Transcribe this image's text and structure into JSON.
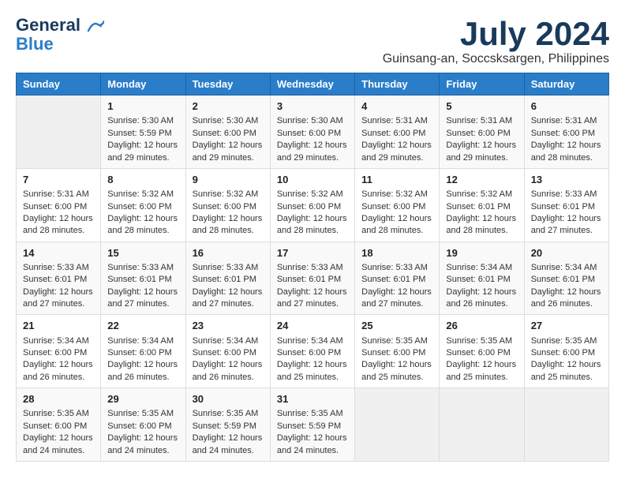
{
  "header": {
    "logo_line1": "General",
    "logo_line2": "Blue",
    "month_year": "July 2024",
    "location": "Guinsang-an, Soccsksargen, Philippines"
  },
  "weekdays": [
    "Sunday",
    "Monday",
    "Tuesday",
    "Wednesday",
    "Thursday",
    "Friday",
    "Saturday"
  ],
  "weeks": [
    [
      {
        "day": "",
        "info": ""
      },
      {
        "day": "1",
        "info": "Sunrise: 5:30 AM\nSunset: 5:59 PM\nDaylight: 12 hours\nand 29 minutes."
      },
      {
        "day": "2",
        "info": "Sunrise: 5:30 AM\nSunset: 6:00 PM\nDaylight: 12 hours\nand 29 minutes."
      },
      {
        "day": "3",
        "info": "Sunrise: 5:30 AM\nSunset: 6:00 PM\nDaylight: 12 hours\nand 29 minutes."
      },
      {
        "day": "4",
        "info": "Sunrise: 5:31 AM\nSunset: 6:00 PM\nDaylight: 12 hours\nand 29 minutes."
      },
      {
        "day": "5",
        "info": "Sunrise: 5:31 AM\nSunset: 6:00 PM\nDaylight: 12 hours\nand 29 minutes."
      },
      {
        "day": "6",
        "info": "Sunrise: 5:31 AM\nSunset: 6:00 PM\nDaylight: 12 hours\nand 28 minutes."
      }
    ],
    [
      {
        "day": "7",
        "info": "Sunrise: 5:31 AM\nSunset: 6:00 PM\nDaylight: 12 hours\nand 28 minutes."
      },
      {
        "day": "8",
        "info": "Sunrise: 5:32 AM\nSunset: 6:00 PM\nDaylight: 12 hours\nand 28 minutes."
      },
      {
        "day": "9",
        "info": "Sunrise: 5:32 AM\nSunset: 6:00 PM\nDaylight: 12 hours\nand 28 minutes."
      },
      {
        "day": "10",
        "info": "Sunrise: 5:32 AM\nSunset: 6:00 PM\nDaylight: 12 hours\nand 28 minutes."
      },
      {
        "day": "11",
        "info": "Sunrise: 5:32 AM\nSunset: 6:00 PM\nDaylight: 12 hours\nand 28 minutes."
      },
      {
        "day": "12",
        "info": "Sunrise: 5:32 AM\nSunset: 6:01 PM\nDaylight: 12 hours\nand 28 minutes."
      },
      {
        "day": "13",
        "info": "Sunrise: 5:33 AM\nSunset: 6:01 PM\nDaylight: 12 hours\nand 27 minutes."
      }
    ],
    [
      {
        "day": "14",
        "info": "Sunrise: 5:33 AM\nSunset: 6:01 PM\nDaylight: 12 hours\nand 27 minutes."
      },
      {
        "day": "15",
        "info": "Sunrise: 5:33 AM\nSunset: 6:01 PM\nDaylight: 12 hours\nand 27 minutes."
      },
      {
        "day": "16",
        "info": "Sunrise: 5:33 AM\nSunset: 6:01 PM\nDaylight: 12 hours\nand 27 minutes."
      },
      {
        "day": "17",
        "info": "Sunrise: 5:33 AM\nSunset: 6:01 PM\nDaylight: 12 hours\nand 27 minutes."
      },
      {
        "day": "18",
        "info": "Sunrise: 5:33 AM\nSunset: 6:01 PM\nDaylight: 12 hours\nand 27 minutes."
      },
      {
        "day": "19",
        "info": "Sunrise: 5:34 AM\nSunset: 6:01 PM\nDaylight: 12 hours\nand 26 minutes."
      },
      {
        "day": "20",
        "info": "Sunrise: 5:34 AM\nSunset: 6:01 PM\nDaylight: 12 hours\nand 26 minutes."
      }
    ],
    [
      {
        "day": "21",
        "info": "Sunrise: 5:34 AM\nSunset: 6:00 PM\nDaylight: 12 hours\nand 26 minutes."
      },
      {
        "day": "22",
        "info": "Sunrise: 5:34 AM\nSunset: 6:00 PM\nDaylight: 12 hours\nand 26 minutes."
      },
      {
        "day": "23",
        "info": "Sunrise: 5:34 AM\nSunset: 6:00 PM\nDaylight: 12 hours\nand 26 minutes."
      },
      {
        "day": "24",
        "info": "Sunrise: 5:34 AM\nSunset: 6:00 PM\nDaylight: 12 hours\nand 25 minutes."
      },
      {
        "day": "25",
        "info": "Sunrise: 5:35 AM\nSunset: 6:00 PM\nDaylight: 12 hours\nand 25 minutes."
      },
      {
        "day": "26",
        "info": "Sunrise: 5:35 AM\nSunset: 6:00 PM\nDaylight: 12 hours\nand 25 minutes."
      },
      {
        "day": "27",
        "info": "Sunrise: 5:35 AM\nSunset: 6:00 PM\nDaylight: 12 hours\nand 25 minutes."
      }
    ],
    [
      {
        "day": "28",
        "info": "Sunrise: 5:35 AM\nSunset: 6:00 PM\nDaylight: 12 hours\nand 24 minutes."
      },
      {
        "day": "29",
        "info": "Sunrise: 5:35 AM\nSunset: 6:00 PM\nDaylight: 12 hours\nand 24 minutes."
      },
      {
        "day": "30",
        "info": "Sunrise: 5:35 AM\nSunset: 5:59 PM\nDaylight: 12 hours\nand 24 minutes."
      },
      {
        "day": "31",
        "info": "Sunrise: 5:35 AM\nSunset: 5:59 PM\nDaylight: 12 hours\nand 24 minutes."
      },
      {
        "day": "",
        "info": ""
      },
      {
        "day": "",
        "info": ""
      },
      {
        "day": "",
        "info": ""
      }
    ]
  ]
}
